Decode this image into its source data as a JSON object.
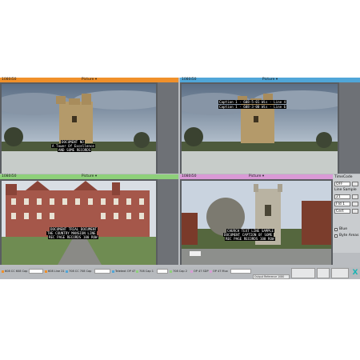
{
  "panes": [
    {
      "resolution": "1080i50",
      "mode": "Picture",
      "accent": "#f0902a",
      "captions": [
        "DOCUMENT NO",
        "A Tower Of Excellence",
        "AND SOME RECORDS"
      ]
    },
    {
      "resolution": "1080i50",
      "mode": "Picture",
      "accent": "#50a6d8",
      "captions": [
        "Caption 1 - 608-5-01 Wis - Line 4",
        "Caption 1 - 608-3-00 Wis - Line 6"
      ]
    },
    {
      "resolution": "1080i50",
      "mode": "Picture",
      "accent": "#8ed07a",
      "captions": [
        "DOCUMENT TRIAL DOCUMENT",
        "THE COUNTRY MANSION LINE",
        "REC PAGE RECORDS 100 ROW"
      ]
    },
    {
      "resolution": "1080i50",
      "mode": "Picture",
      "accent": "#d99ad6",
      "captions": [
        "CHURCH TEXT LINE SAMPLE",
        "DOCUMENT CAPTION OF SOME",
        "REC PAGE RECORDS 100 ROW"
      ]
    }
  ],
  "controls": {
    "title": "TimeCode",
    "mode_value": "OFF",
    "line_sample_label": "Line Sample",
    "line_value": "21",
    "field_value": "Fld 1",
    "source_value": "Cert",
    "blue_label": "Blue",
    "byte_areas_label": "Byte Areas"
  },
  "statusbar": {
    "items": [
      {
        "text": "608 CC 608 Cap",
        "color": "#f0902a"
      },
      {
        "text": "608 Line 21",
        "color": "#f0902a"
      },
      {
        "text": "708 CC 708 Cap",
        "color": "#50a6d8"
      },
      {
        "text": "Teletext OP 47",
        "color": "#50a6d8"
      },
      {
        "text": "708 Cap 1",
        "color": "#8ed07a"
      },
      {
        "text": "708 Cap 2",
        "color": "#8ed07a"
      },
      {
        "text": "OP 47 SDP",
        "color": "#d99ad6"
      },
      {
        "text": "OP 47 Mux",
        "color": "#d99ad6"
      }
    ],
    "info_text": "Output Reference 1080",
    "close_label": "X",
    "close_color": "#19b3b3"
  }
}
